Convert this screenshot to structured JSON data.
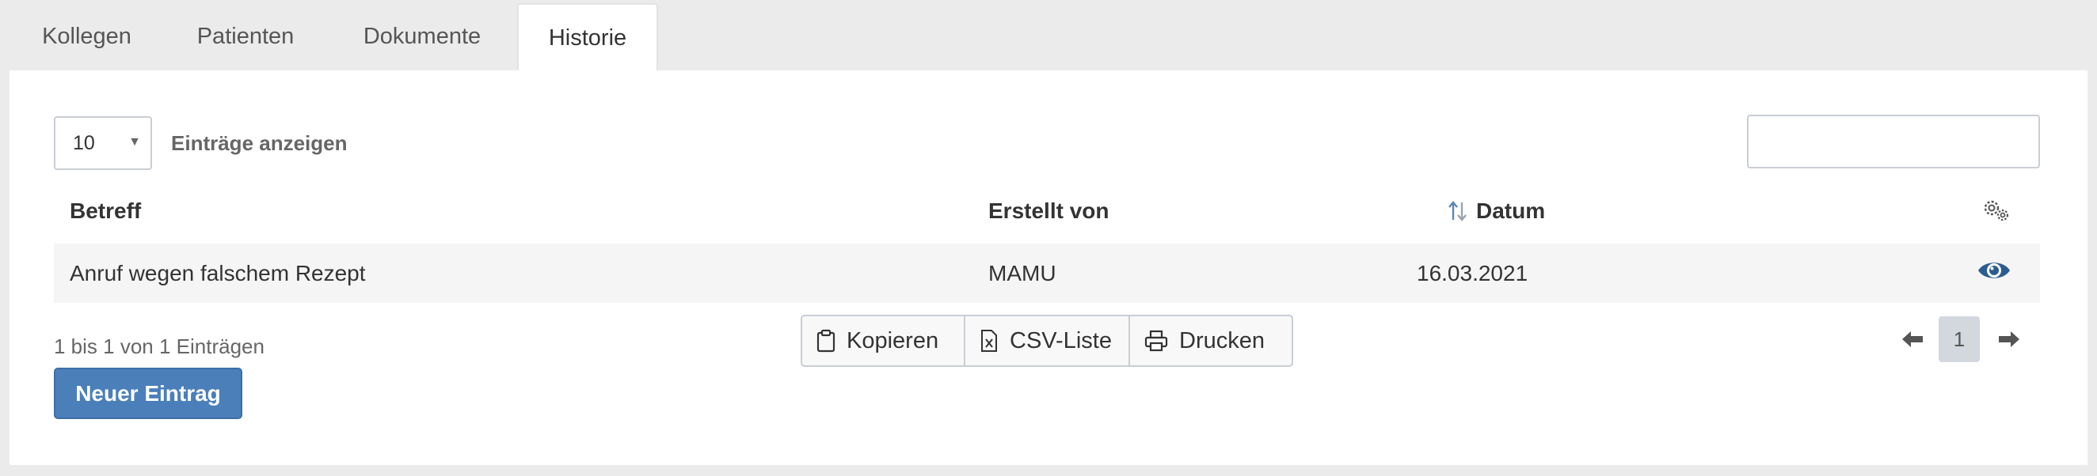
{
  "tabs": [
    {
      "label": "Kollegen"
    },
    {
      "label": "Patienten"
    },
    {
      "label": "Dokumente"
    },
    {
      "label": "Historie",
      "active": true
    }
  ],
  "length_select": {
    "value": "10",
    "label": "Einträge anzeigen"
  },
  "search": {
    "placeholder": ""
  },
  "table": {
    "headers": {
      "subject": "Betreff",
      "created_by": "Erstellt von",
      "date": "Datum"
    },
    "rows": [
      {
        "subject": "Anruf wegen falschem Rezept",
        "created_by": "MAMU",
        "date": "16.03.2021"
      }
    ]
  },
  "info_text": "1 bis 1 von 1 Einträgen",
  "buttons": {
    "copy": "Kopieren",
    "csv": "CSV-Liste",
    "print": "Drucken"
  },
  "pagination": {
    "current": "1"
  },
  "new_entry_label": "Neuer Eintrag",
  "colors": {
    "accent": "#4a7fba",
    "eye_icon": "#2c5c8f"
  }
}
